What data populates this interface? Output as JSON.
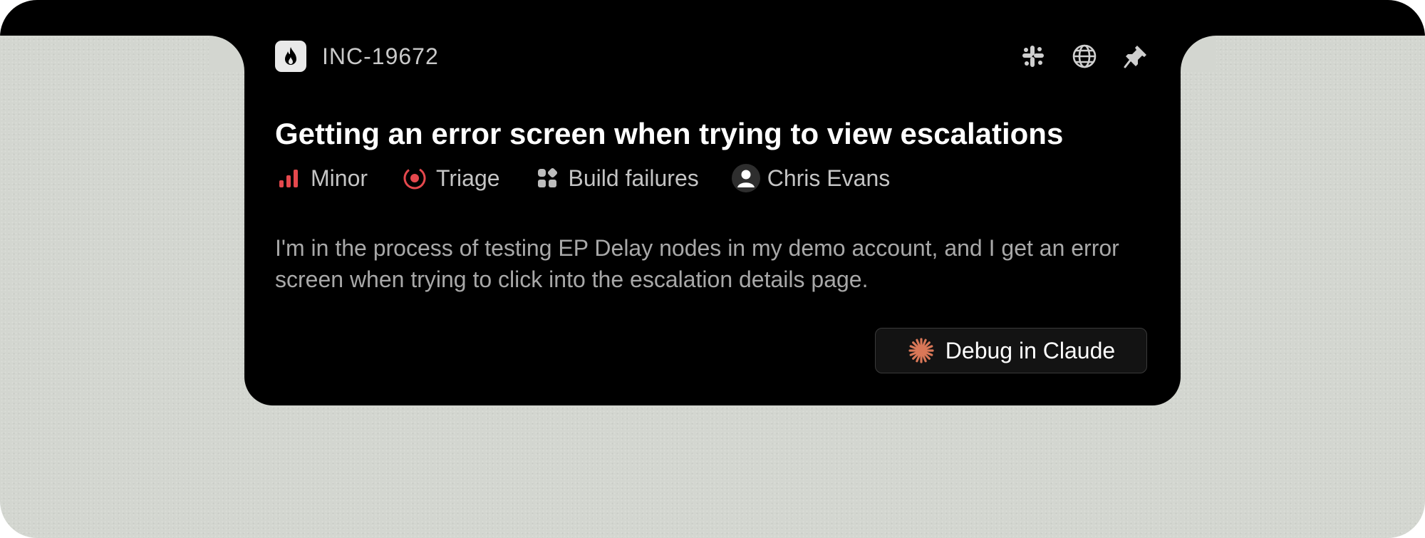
{
  "incident": {
    "id": "INC-19672",
    "title": "Getting an error screen when trying to view escalations",
    "description": "I'm in the process of testing EP Delay nodes in my demo account, and I get an error screen when trying to click into the escalation details page."
  },
  "header_icons": [
    "fire-icon",
    "slack-icon",
    "globe-icon",
    "pin-icon"
  ],
  "meta": {
    "severity": "Minor",
    "status": "Triage",
    "category": "Build failures",
    "assignee": "Chris Evans"
  },
  "actions": {
    "debug_label": "Debug in Claude"
  },
  "colors": {
    "severity": "#e5484d",
    "status": "#e5484d",
    "claude_accent": "#d97757",
    "card_background": "#000000",
    "page_background": "#d3d6d0"
  }
}
